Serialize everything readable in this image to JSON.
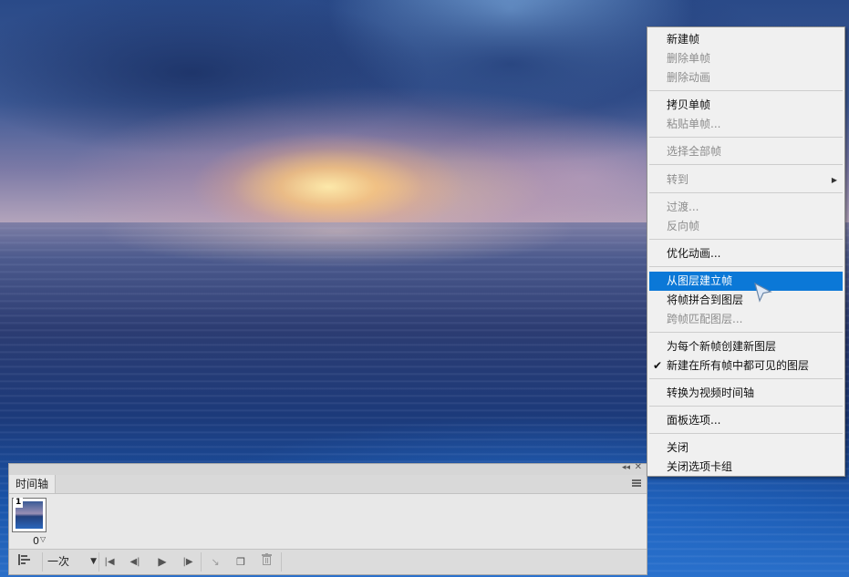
{
  "timeline": {
    "tab_label": "时间轴",
    "frame_number": "1",
    "frame_delay": "0",
    "loop_label": "一次",
    "icons": {
      "convert": "convert-timeline-icon",
      "first": "first-frame-icon",
      "prev": "previous-frame-icon",
      "play": "play-icon",
      "next": "next-frame-icon",
      "tween": "tween-icon",
      "duplicate": "duplicate-frame-icon",
      "delete": "trash-icon"
    }
  },
  "menu": {
    "new_frame": "新建帧",
    "delete_frame": "删除单帧",
    "delete_animation": "删除动画",
    "copy_frame": "拷贝单帧",
    "paste_frame": "粘贴单帧...",
    "select_all": "选择全部帧",
    "goto": "转到",
    "tween": "过渡...",
    "reverse": "反向帧",
    "optimize": "优化动画...",
    "make_from_layers": "从图层建立帧",
    "flatten": "将帧拼合到图层",
    "match_layer": "跨帧匹配图层...",
    "create_new_layer": "为每个新帧创建新图层",
    "new_layers_visible": "新建在所有帧中都可见的图层",
    "convert_video": "转换为视频时间轴",
    "panel_options": "面板选项...",
    "close": "关闭",
    "close_tab_group": "关闭选项卡组"
  },
  "colors": {
    "menu_highlight": "#0b78d7",
    "menu_bg": "#f0f0f0",
    "panel_bg": "#e8e8e8"
  }
}
